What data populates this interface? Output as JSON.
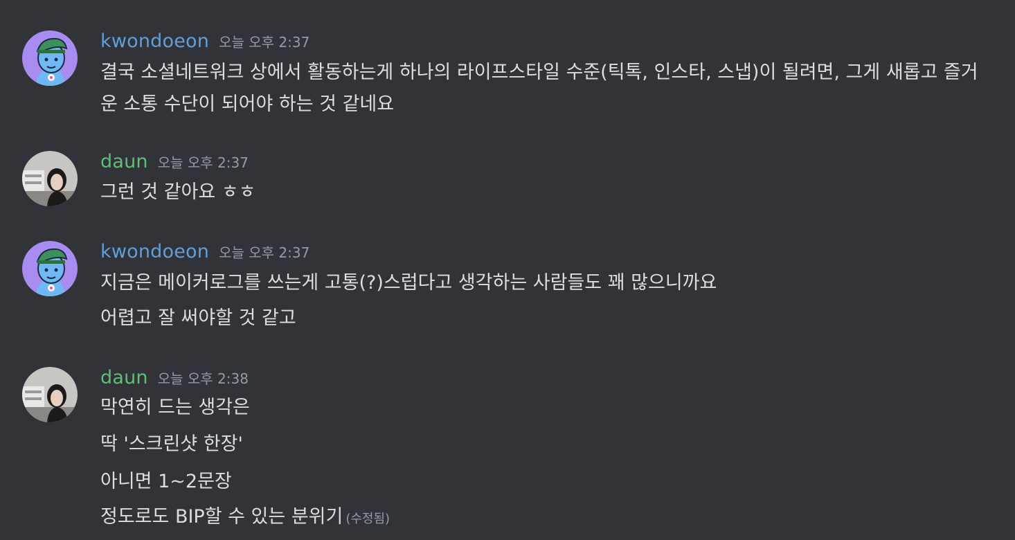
{
  "users": {
    "kwondoeon": {
      "name": "kwondoeon",
      "color": "#5f9fdc"
    },
    "daun": {
      "name": "daun",
      "color": "#5fbf7a"
    }
  },
  "messages": [
    {
      "author": "kwondoeon",
      "timestamp": "오늘 오후 2:37",
      "lines": [
        "결국 소셜네트워크 상에서 활동하는게 하나의 라이프스타일 수준(틱톡, 인스타, 스냅)이 될려면, 그게 새롭고 즐거운 소통 수단이 되어야 하는 것 같네요"
      ]
    },
    {
      "author": "daun",
      "timestamp": "오늘 오후 2:37",
      "lines": [
        "그런 것 같아요 ㅎㅎ"
      ]
    },
    {
      "author": "kwondoeon",
      "timestamp": "오늘 오후 2:37",
      "lines": [
        "지금은 메이커로그를 쓰는게 고통(?)스럽다고 생각하는 사람들도 꽤 많으니까요",
        "어렵고 잘 써야할 것 같고"
      ]
    },
    {
      "author": "daun",
      "timestamp": "오늘 오후 2:38",
      "lines": [
        "막연히 드는 생각은",
        "딱 '스크린샷 한장'",
        "아니면 1~2문장",
        "정도로도 BIP할 수 있는 분위기"
      ],
      "edited_label": "(수정됨)"
    }
  ]
}
